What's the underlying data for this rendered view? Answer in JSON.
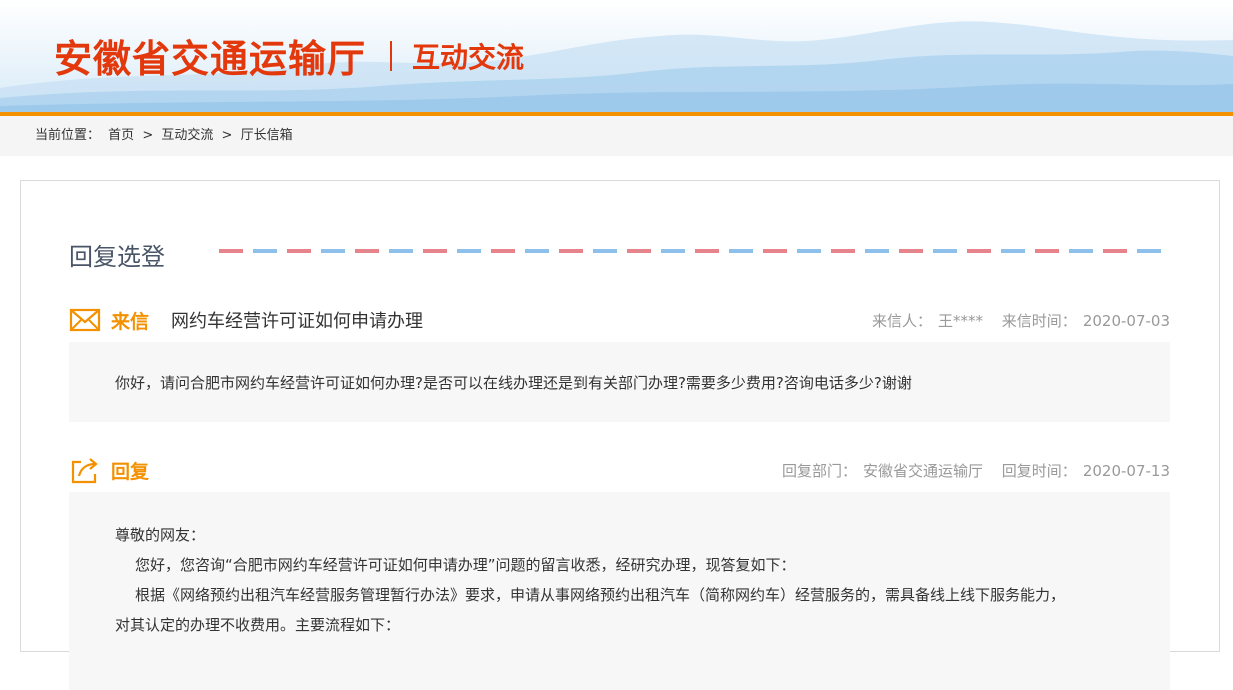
{
  "header": {
    "org_name": "安徽省交通运输厅",
    "section_name": "互动交流"
  },
  "breadcrumb": {
    "prefix": "当前位置：",
    "items": [
      "首页",
      "互动交流",
      "厅长信箱"
    ],
    "separator": ">"
  },
  "panel": {
    "title": "回复选登",
    "letter": {
      "tag": "来信",
      "subject": "网约车经营许可证如何申请办理",
      "sender_label": "来信人：",
      "sender": "王****",
      "time_label": "来信时间：",
      "time": "2020-07-03",
      "body": "你好，请问合肥市网约车经营许可证如何办理?是否可以在线办理还是到有关部门办理?需要多少费用?咨询电话多少?谢谢"
    },
    "reply": {
      "tag": "回复",
      "dept_label": "回复部门：",
      "dept": "安徽省交通运输厅",
      "time_label": "回复时间：",
      "time": "2020-07-13",
      "lines": [
        "尊敬的网友：",
        "您好，您咨询“合肥市网约车经营许可证如何申请办理”问题的留言收悉，经研究办理，现答复如下：",
        "根据《网络预约出租汽车经营服务管理暂行办法》要求，申请从事网络预约出租汽车（简称网约车）经营服务的，需具备线上线下服务能力，",
        "对其认定的办理不收费用。主要流程如下："
      ]
    }
  },
  "colors": {
    "brand": "#e2380c",
    "accent": "#f39100",
    "dash_red": "#e7838a",
    "dash_blue": "#8dc0ea"
  },
  "icons": {
    "letter": "envelope-icon",
    "reply": "share-reply-icon"
  }
}
